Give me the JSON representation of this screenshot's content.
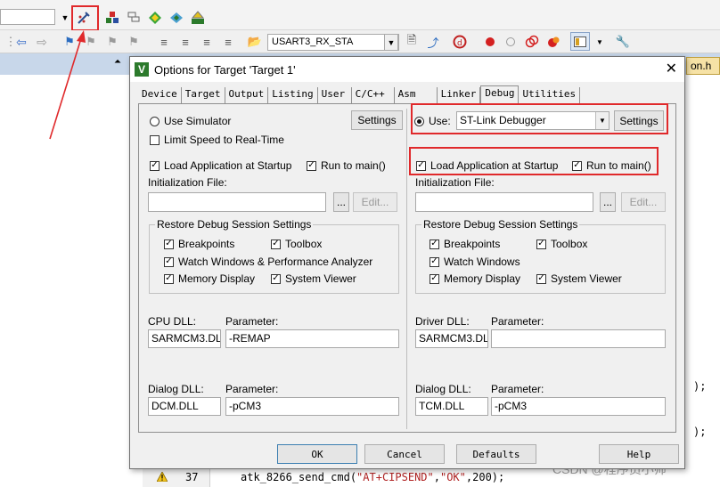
{
  "ide": {
    "target_combo": "USART3_RX_STA",
    "file_tab": "on.h",
    "code_line_no": "37",
    "code_prefix": "atk_8266_send_cmd(",
    "code_str1": "\"AT+CIPSEND\"",
    "code_comma": ",",
    "code_str2": "\"OK\"",
    "code_suffix": ",200);",
    "right_frag1": ");",
    "right_frag2": ");",
    "watermark": "CSDN @程序员小帅"
  },
  "dialog": {
    "title": "Options for Target 'Target 1'",
    "close": "✕",
    "tabs": [
      "Device",
      "Target",
      "Output",
      "Listing",
      "User",
      "C/C++",
      "Asm",
      "Linker",
      "Debug",
      "Utilities"
    ],
    "active_tab": "Debug",
    "left": {
      "use_simulator": "Use Simulator",
      "limit_speed": "Limit Speed to Real-Time",
      "settings": "Settings",
      "load_app": "Load Application at Startup",
      "run_to_main": "Run to main()",
      "init_file": "Initialization File:",
      "browse": "...",
      "edit": "Edit...",
      "restore_group": "Restore Debug Session Settings",
      "breakpoints": "Breakpoints",
      "toolbox": "Toolbox",
      "watch": "Watch Windows & Performance Analyzer",
      "memory": "Memory Display",
      "system_viewer": "System Viewer",
      "cpu_dll_label": "CPU DLL:",
      "cpu_param_label": "Parameter:",
      "cpu_dll": "SARMCM3.DLL",
      "cpu_param": "-REMAP",
      "dialog_dll_label": "Dialog DLL:",
      "dialog_param_label": "Parameter:",
      "dialog_dll": "DCM.DLL",
      "dialog_param": "-pCM3"
    },
    "right": {
      "use": "Use:",
      "debugger": "ST-Link Debugger",
      "settings": "Settings",
      "load_app": "Load Application at Startup",
      "run_to_main": "Run to main()",
      "init_file": "Initialization File:",
      "browse": "...",
      "edit": "Edit...",
      "restore_group": "Restore Debug Session Settings",
      "breakpoints": "Breakpoints",
      "toolbox": "Toolbox",
      "watch": "Watch Windows",
      "memory": "Memory Display",
      "system_viewer": "System Viewer",
      "driver_dll_label": "Driver DLL:",
      "driver_param_label": "Parameter:",
      "driver_dll": "SARMCM3.DLL",
      "driver_param": "",
      "dialog_dll_label": "Dialog DLL:",
      "dialog_param_label": "Parameter:",
      "dialog_dll": "TCM.DLL",
      "dialog_param": "-pCM3"
    },
    "buttons": {
      "ok": "OK",
      "cancel": "Cancel",
      "defaults": "Defaults",
      "help": "Help"
    }
  },
  "colors": {
    "highlight_red": "#e0292b",
    "tabstrip": "#c8d7ea"
  }
}
